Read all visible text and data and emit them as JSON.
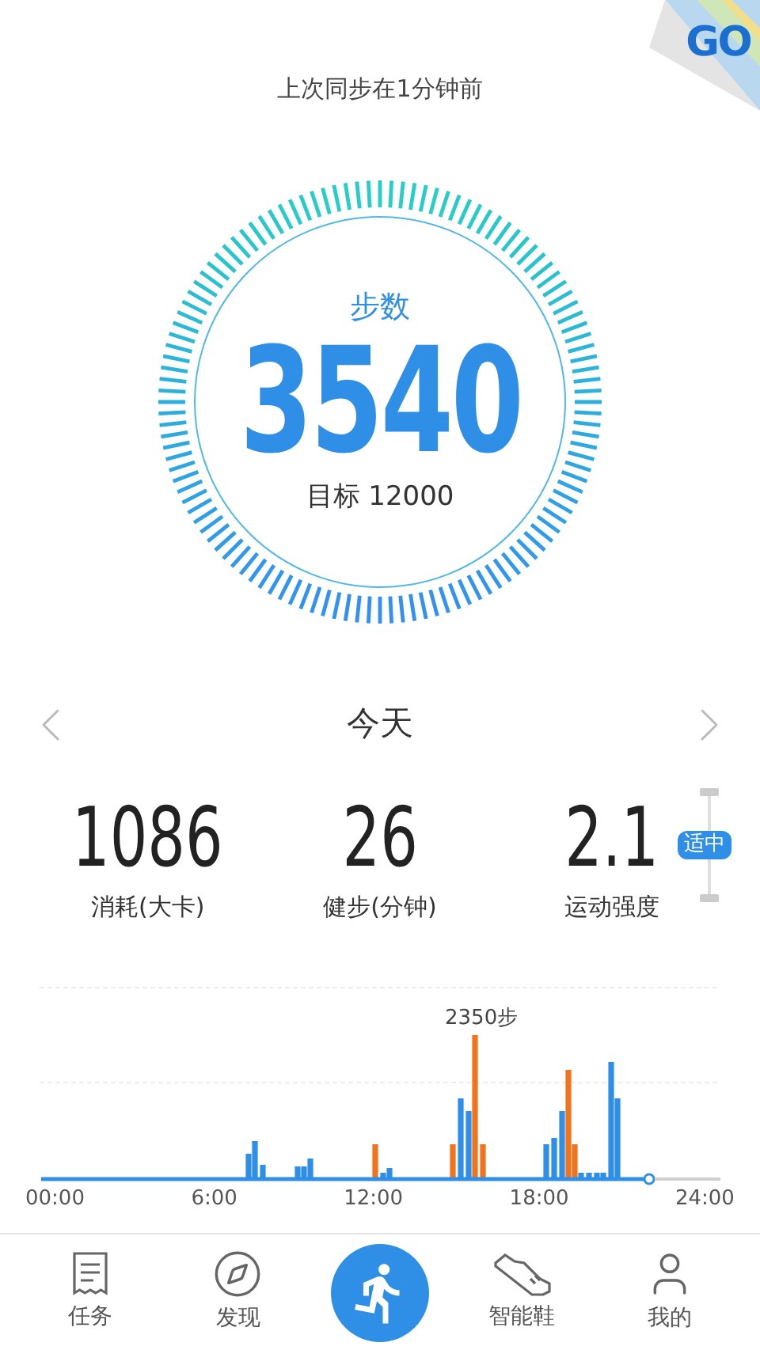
{
  "corner_badge": {
    "label": "GO"
  },
  "sync_status": "上次同步在1分钟前",
  "steps": {
    "label": "步数",
    "value": "3540",
    "goal": "目标 12000"
  },
  "day": {
    "label": "今天"
  },
  "stats": [
    {
      "value": "1086",
      "label": "消耗(大卡)",
      "kind": "plain"
    },
    {
      "value": "26",
      "label": "健步(分钟)",
      "kind": "plain"
    },
    {
      "value": "2.1",
      "label": "运动强度",
      "kind": "intensity",
      "badge": "适中"
    }
  ],
  "activity": {
    "peak_label": "2350步",
    "axis_labels": [
      "00:00",
      "6:00",
      "12:00",
      "18:00",
      "24:00"
    ]
  },
  "nav": [
    {
      "kind": "tab",
      "label": "任务"
    },
    {
      "kind": "tab",
      "label": "发现"
    },
    {
      "kind": "main"
    },
    {
      "kind": "tab",
      "label": "智能鞋"
    },
    {
      "kind": "tab",
      "label": "我的"
    }
  ]
}
